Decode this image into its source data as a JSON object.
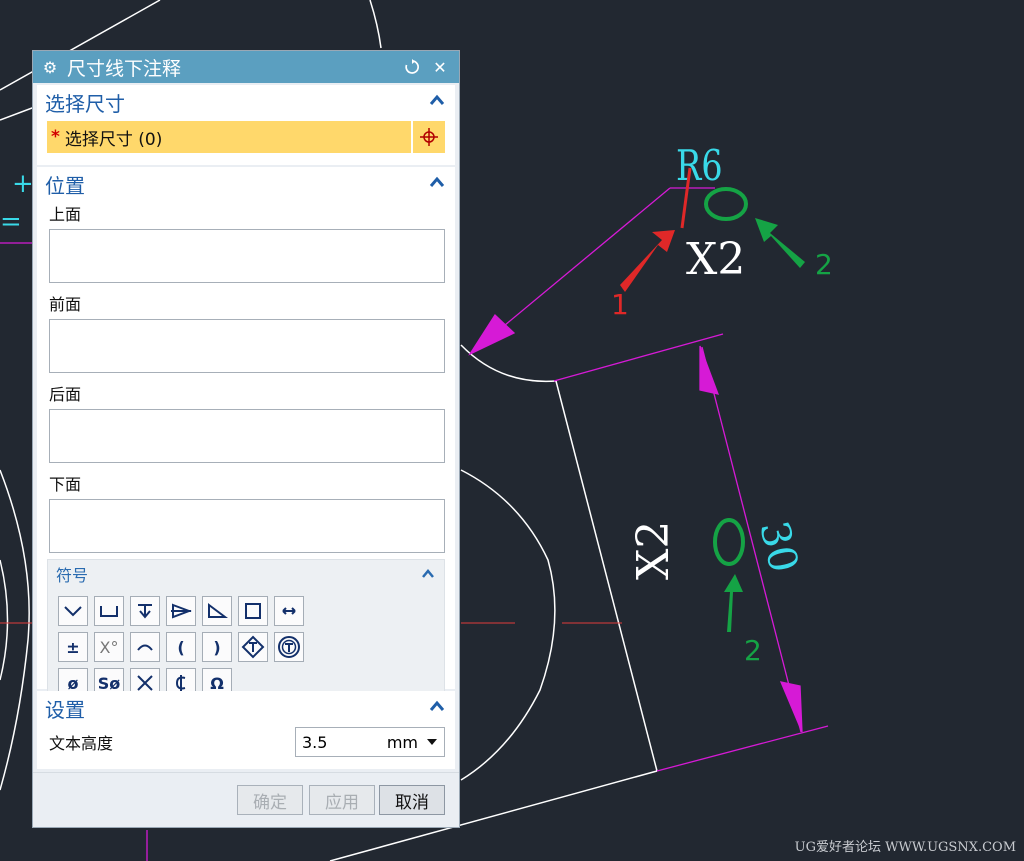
{
  "drawing": {
    "dim_r6": "R6",
    "dim_x2_top": "X2",
    "dim_30": "30",
    "dim_x2_right": "X2",
    "arrow_label_1": "1",
    "arrow_label_2a": "2",
    "arrow_label_2b": "2",
    "left_edge_text_a": "+(",
    "left_edge_text_b": "= (",
    "watermark": "UG爱好者论坛 WWW.UGSNX.COM",
    "colors": {
      "background": "#222831",
      "geometry": "#ffffff",
      "dimension_line": "#d61ad6",
      "dimension_text": "#39d9e8",
      "annotation_green": "#15a345",
      "annotation_red": "#e02828",
      "centerline": "#e03b3b"
    }
  },
  "dialog": {
    "title": "尺寸线下注释",
    "icons": {
      "title": "gear-icon",
      "reset": "reset-icon",
      "close": "close-icon"
    },
    "sections": {
      "select": {
        "title": "选择尺寸",
        "field_label": "选择尺寸 (0)",
        "required_mark": "*"
      },
      "position": {
        "title": "位置",
        "fields": [
          {
            "label": "上面",
            "value": ""
          },
          {
            "label": "前面",
            "value": ""
          },
          {
            "label": "后面",
            "value": ""
          },
          {
            "label": "下面",
            "value": ""
          }
        ]
      },
      "symbols": {
        "title": "符号",
        "items": [
          "depth-icon",
          "counterbore-icon",
          "countersink-icon",
          "conical-taper-icon",
          "slope-icon",
          "square-icon",
          "arc-length-icon",
          "plus-minus-icon",
          "degree-icon",
          "arc-icon",
          "left-paren-icon",
          "right-paren-icon",
          "pattern-icon",
          "spotface-icon",
          "diameter-icon",
          "spherical-diameter-icon",
          "x-icon",
          "centerline-icon",
          "omega-icon"
        ],
        "glyphs": {
          "plus_minus": "±",
          "degree": "X°",
          "left_paren": "(",
          "right_paren": ")",
          "diameter": "ø",
          "spherical_diameter": "Sø",
          "omega": "Ω"
        }
      },
      "settings": {
        "title": "设置",
        "text_height_label": "文本高度",
        "text_height_value": "3.5",
        "text_height_unit": "mm"
      }
    },
    "buttons": {
      "ok": "确定",
      "apply": "应用",
      "cancel": "取消"
    }
  }
}
